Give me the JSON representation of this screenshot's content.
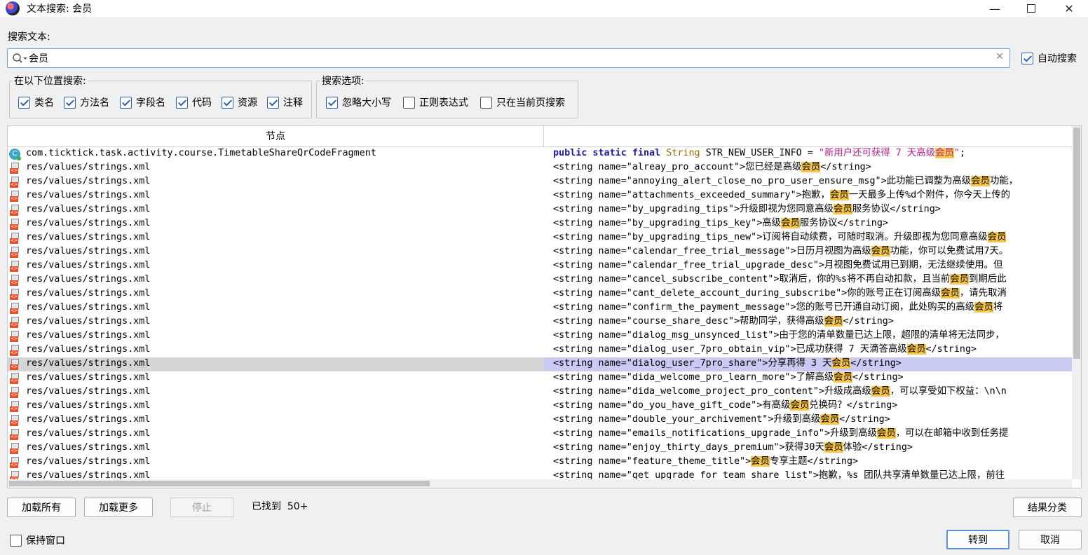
{
  "window": {
    "title": "文本搜索: 会员",
    "minimize": "—",
    "close": "✕"
  },
  "search": {
    "label": "搜索文本:",
    "value": "会员",
    "clear": "✕",
    "auto_label": "自动搜索",
    "auto_checked": true
  },
  "location_group": {
    "title": "在以下位置搜索:",
    "options": [
      {
        "label": "类名",
        "checked": true
      },
      {
        "label": "方法名",
        "checked": true
      },
      {
        "label": "字段名",
        "checked": true
      },
      {
        "label": "代码",
        "checked": true
      },
      {
        "label": "资源",
        "checked": true
      },
      {
        "label": "注释",
        "checked": true
      }
    ]
  },
  "options_group": {
    "title": "搜索选项:",
    "options": [
      {
        "label": "忽略大小写",
        "checked": true
      },
      {
        "label": "正则表达式",
        "checked": false
      },
      {
        "label": "只在当前页搜索",
        "checked": false
      }
    ]
  },
  "table": {
    "header_node": "节点",
    "header_code": "",
    "highlight_color": "#f7c64a",
    "selected_row": 15,
    "rows": [
      {
        "icon": "class-icon",
        "node": "com.ticktick.task.activity.course.TimetableShareQrCodeFragment",
        "code_kind": "java",
        "kw": "public static final",
        "type": "String",
        "name": " STR_NEW_USER_INFO = ",
        "str1": "\"新用户还可获得 7 天高级",
        "str_hl": "会员",
        "str2": "\"",
        "tail": ";"
      },
      {
        "icon": "xml-resource-icon",
        "node": "res/values/strings.xml",
        "pre": "<string name=\"alreay_pro_account\">您已经是高级",
        "hl": "会员",
        "post": "</string>"
      },
      {
        "icon": "xml-resource-icon",
        "node": "res/values/strings.xml",
        "pre": "<string name=\"annoying_alert_close_no_pro_user_ensure_msg\">此功能已调整为高级",
        "hl": "会员",
        "post": "功能，"
      },
      {
        "icon": "xml-resource-icon",
        "node": "res/values/strings.xml",
        "pre": "<string name=\"attachments_exceeded_summary\">抱歉，",
        "hl": "会员",
        "post": "一天最多上传%d个附件，你今天上传的"
      },
      {
        "icon": "xml-resource-icon",
        "node": "res/values/strings.xml",
        "pre": "<string name=\"by_upgrading_tips\">升级即视为您同意高级",
        "hl": "会员",
        "post": "服务协议</string>"
      },
      {
        "icon": "xml-resource-icon",
        "node": "res/values/strings.xml",
        "pre": "<string name=\"by_upgrading_tips_key\">高级",
        "hl": "会员",
        "post": "服务协议</string>"
      },
      {
        "icon": "xml-resource-icon",
        "node": "res/values/strings.xml",
        "pre": "<string name=\"by_upgrading_tips_new\">订阅将自动续费，可随时取消。升级即视为您同意高级",
        "hl": "会员",
        "post": ""
      },
      {
        "icon": "xml-resource-icon",
        "node": "res/values/strings.xml",
        "pre": "<string name=\"calendar_free_trial_message\">日历月视图为高级",
        "hl": "会员",
        "post": "功能，你可以免费试用7天。"
      },
      {
        "icon": "xml-resource-icon",
        "node": "res/values/strings.xml",
        "pre": "<string name=\"calendar_free_trial_upgrade_desc\">月视图免费试用已到期，无法继续使用。但",
        "hl": "",
        "post": ""
      },
      {
        "icon": "xml-resource-icon",
        "node": "res/values/strings.xml",
        "pre": "<string name=\"cancel_subscribe_content\">取消后，你的%s将不再自动扣款，且当前",
        "hl": "会员",
        "post": "到期后此"
      },
      {
        "icon": "xml-resource-icon",
        "node": "res/values/strings.xml",
        "pre": "<string name=\"cant_delete_account_during_subscribe\">你的账号正在订阅高级",
        "hl": "会员",
        "post": "，请先取消"
      },
      {
        "icon": "xml-resource-icon",
        "node": "res/values/strings.xml",
        "pre": "<string name=\"confirm_the_payment_message\">您的账号已开通自动订阅，此处购买的高级",
        "hl": "会员",
        "post": "将"
      },
      {
        "icon": "xml-resource-icon",
        "node": "res/values/strings.xml",
        "pre": "<string name=\"course_share_desc\">帮助同学，获得高级",
        "hl": "会员",
        "post": "</string>"
      },
      {
        "icon": "xml-resource-icon",
        "node": "res/values/strings.xml",
        "pre": "<string name=\"dialog_msg_unsynced_list\">由于您的清单数量已达上限，超限的清单将无法同步，",
        "hl": "",
        "post": ""
      },
      {
        "icon": "xml-resource-icon",
        "node": "res/values/strings.xml",
        "pre": "<string name=\"dialog_user_7pro_obtain_vip\">已成功获得 7 天滴答高级",
        "hl": "会员",
        "post": "</string>"
      },
      {
        "icon": "xml-resource-icon",
        "node": "res/values/strings.xml",
        "pre": "<string name=\"dialog_user_7pro_share\">分享再得 3 天",
        "hl": "会员",
        "post": "</string>"
      },
      {
        "icon": "xml-resource-icon",
        "node": "res/values/strings.xml",
        "pre": "<string name=\"dida_welcome_pro_learn_more\">了解高级",
        "hl": "会员",
        "post": "</string>"
      },
      {
        "icon": "xml-resource-icon",
        "node": "res/values/strings.xml",
        "pre": "<string name=\"dida_welcome_project_pro_content\">升级成高级",
        "hl": "会员",
        "post": "，可以享受如下权益：\\n\\n"
      },
      {
        "icon": "xml-resource-icon",
        "node": "res/values/strings.xml",
        "pre": "<string name=\"do_you_have_gift_code\">有高级",
        "hl": "会员",
        "post": "兑换码？</string>"
      },
      {
        "icon": "xml-resource-icon",
        "node": "res/values/strings.xml",
        "pre": "<string name=\"double_your_archivement\">升级到高级",
        "hl": "会员",
        "post": "</string>"
      },
      {
        "icon": "xml-resource-icon",
        "node": "res/values/strings.xml",
        "pre": "<string name=\"emails_notifications_upgrade_info\">升级到高级",
        "hl": "会员",
        "post": "，可以在邮箱中收到任务提"
      },
      {
        "icon": "xml-resource-icon",
        "node": "res/values/strings.xml",
        "pre": "<string name=\"enjoy_thirty_days_premium\">获得30天",
        "hl": "会员",
        "post": "体验</string>"
      },
      {
        "icon": "xml-resource-icon",
        "node": "res/values/strings.xml",
        "pre": "<string name=\"feature_theme_title\">",
        "hl": "会员",
        "post": "专享主题</string>"
      },
      {
        "icon": "xml-resource-icon",
        "node": "res/values/strings.xml",
        "pre": "<string name=\"get_upgrade_for_team_share_list\">抱歉，%s 团队共享清单数量已达上限，前往",
        "hl": "",
        "post": ""
      }
    ]
  },
  "buttons": {
    "load_all": "加载所有",
    "load_more": "加载更多",
    "stop": "停止",
    "found": "已找到  50+",
    "classify": "结果分类",
    "goto": "转到",
    "cancel": "取消"
  },
  "keep_window": {
    "label": "保持窗口",
    "checked": false
  }
}
